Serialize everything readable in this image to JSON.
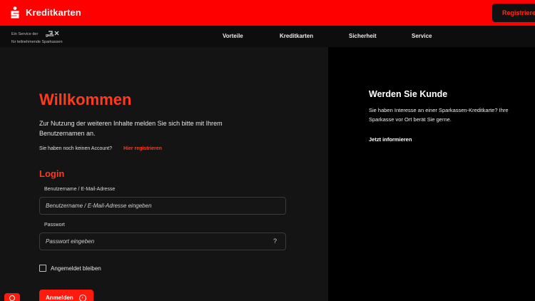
{
  "header": {
    "brand": "Kreditkarten",
    "register_button": "Registrieren"
  },
  "subheader": {
    "service_line": "Ein Service der",
    "service_logo_text": "gads",
    "service_line2": "für teilnehmende Sparkassen"
  },
  "nav": {
    "items": [
      "Vorteile",
      "Kreditkarten",
      "Sicherheit",
      "Service"
    ]
  },
  "main": {
    "title": "Willkommen",
    "intro": "Zur Nutzung der weiteren Inhalte melden Sie sich bitte mit Ihrem Benutzernamen an.",
    "no_account": "Sie haben noch keinen Account?",
    "register_link": "Hier registrieren"
  },
  "login": {
    "title": "Login",
    "username_label": "Benutzername / E-Mail-Adresse",
    "username_placeholder": "Benutzername / E-Mail-Adresse eingeben",
    "password_label": "Passwort",
    "password_placeholder": "Passwort eingeben",
    "password_help": "?",
    "remember_label": "Angemeldet bleiben",
    "submit": "Anmelden"
  },
  "promo": {
    "title": "Werden Sie Kunde",
    "text": "Sie haben Interesse an einer Sparkassen-Kreditkarte? Ihre Sparkasse vor Ort berät Sie gerne.",
    "link": "Jetzt informieren"
  },
  "colors": {
    "brand_red": "#ff0000",
    "accent": "#ff3a1f",
    "background": "#141414",
    "panel": "#000000"
  },
  "icons": [
    "sparkasse-s-icon",
    "gads-logo-icon",
    "help-icon",
    "arrow-right-circle-icon",
    "accessibility-icon"
  ]
}
